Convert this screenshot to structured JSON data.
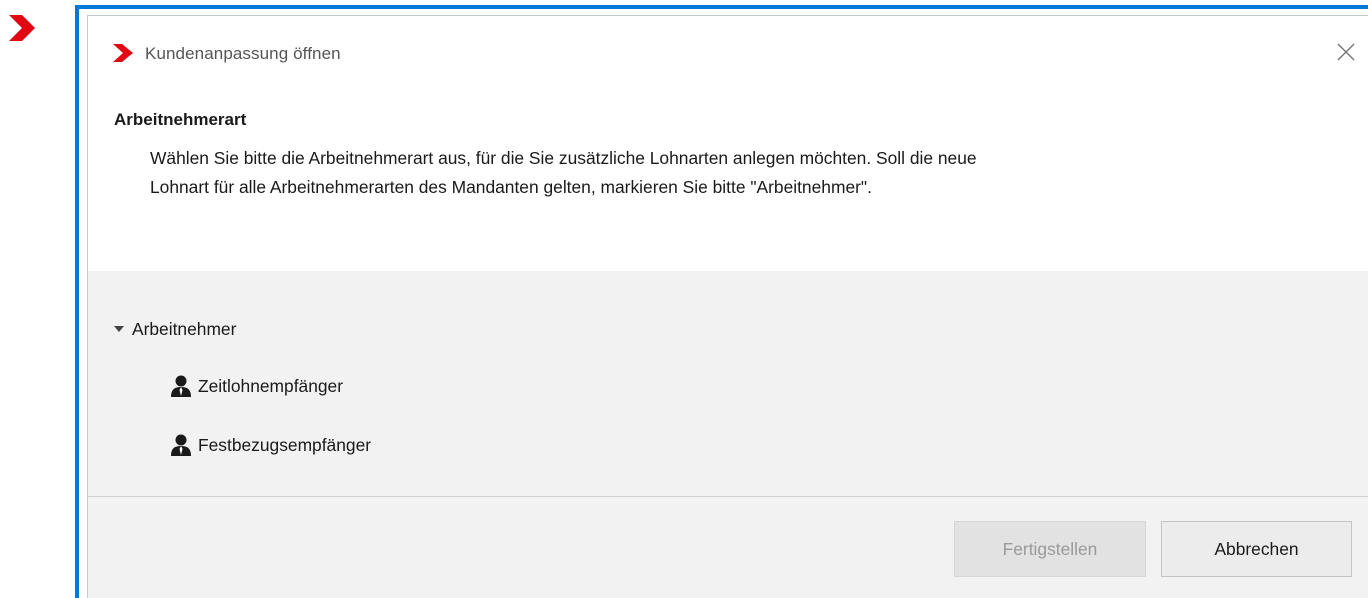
{
  "dialog": {
    "title": "Kundenanpassung öffnen",
    "brand_color": "#e30613",
    "frame_color": "#0078d7"
  },
  "content": {
    "heading": "Arbeitnehmerart",
    "description_line1": "Wählen Sie bitte die Arbeitnehmerart aus, für die Sie zusätzliche Lohnarten anlegen möchten. Soll die neue",
    "description_line2": "Lohnart für alle Arbeitnehmerarten des Mandanten gelten, markieren Sie bitte \"Arbeitnehmer\"."
  },
  "tree": {
    "root": {
      "label": "Arbeitnehmer",
      "expanded": true,
      "icon": "caret-down-icon"
    },
    "children": [
      {
        "label": "Zeitlohnempfänger",
        "icon": "person-icon"
      },
      {
        "label": "Festbezugsempfänger",
        "icon": "person-icon"
      }
    ]
  },
  "footer": {
    "finish_label": "Fertigstellen",
    "finish_enabled": false,
    "cancel_label": "Abbrechen"
  }
}
